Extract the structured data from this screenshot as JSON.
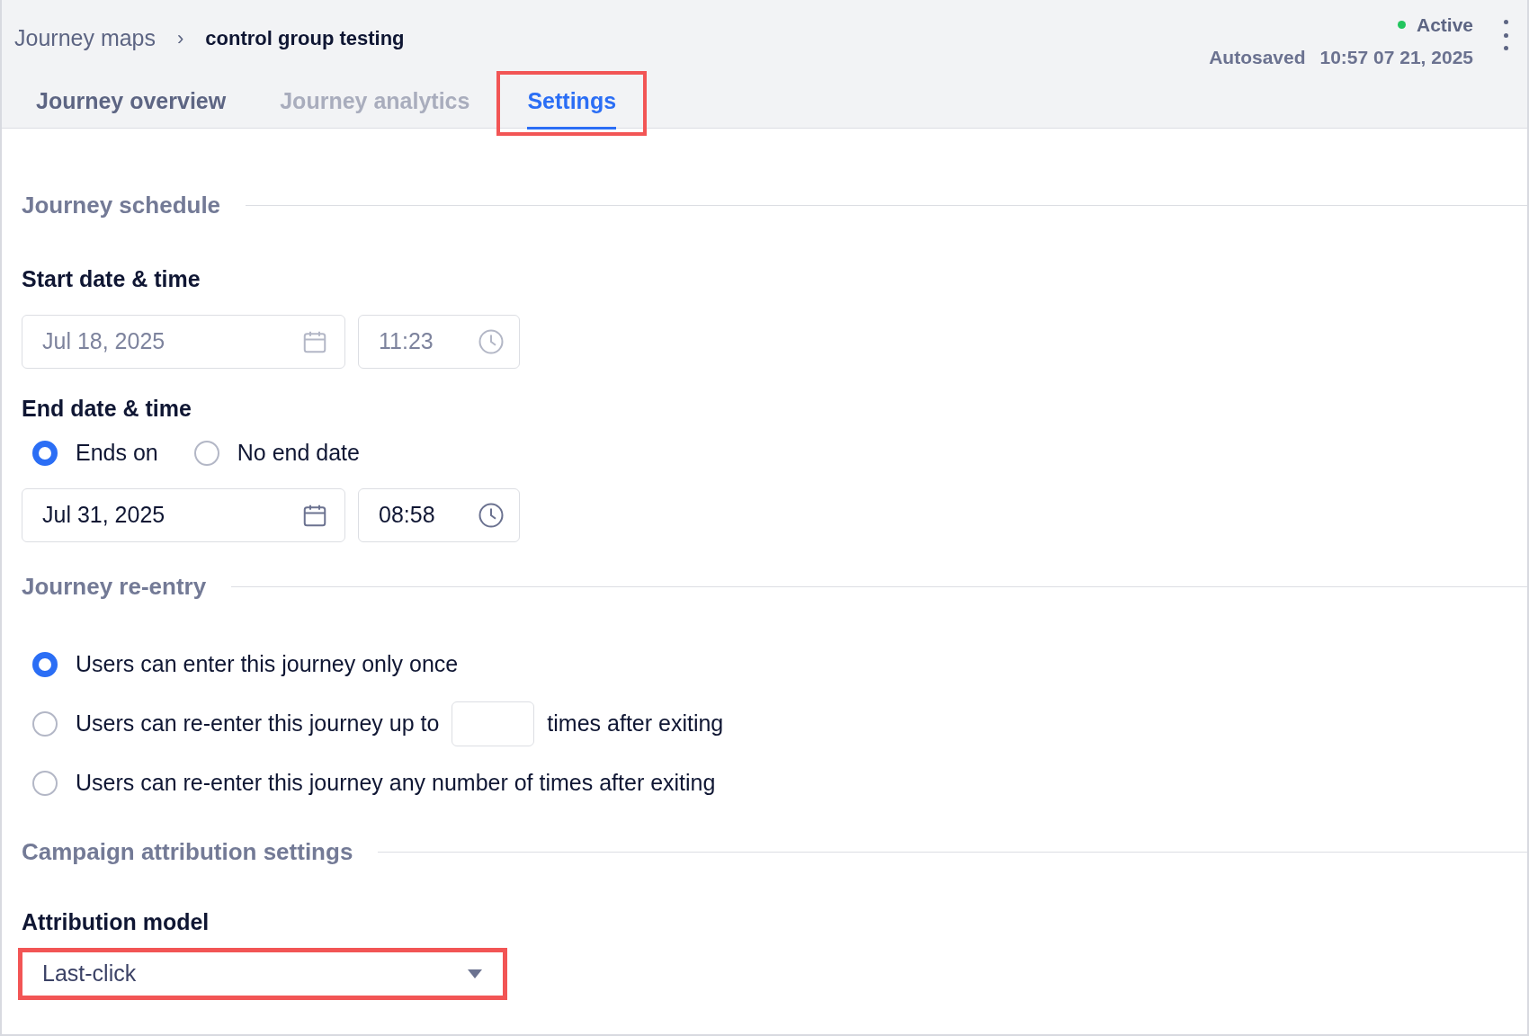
{
  "breadcrumb": {
    "parent": "Journey maps",
    "separator": "›",
    "current": "control group testing"
  },
  "status": {
    "label": "Active",
    "color": "#22c55e",
    "autosaved_label": "Autosaved",
    "autosaved_time": "10:57 07 21, 2025"
  },
  "tabs": [
    {
      "label": "Journey overview",
      "selected": false,
      "disabled": false,
      "highlighted": false
    },
    {
      "label": "Journey analytics",
      "selected": false,
      "disabled": true,
      "highlighted": false
    },
    {
      "label": "Settings",
      "selected": true,
      "disabled": false,
      "highlighted": true
    }
  ],
  "schedule": {
    "heading": "Journey schedule",
    "start": {
      "label": "Start date & time",
      "date": "Jul 18, 2025",
      "time": "11:23",
      "disabled": true
    },
    "end": {
      "label": "End date & time",
      "options": [
        {
          "label": "Ends on",
          "selected": true
        },
        {
          "label": "No end date",
          "selected": false
        }
      ],
      "date": "Jul 31, 2025",
      "time": "08:58",
      "disabled": false
    }
  },
  "reentry": {
    "heading": "Journey re-entry",
    "options": [
      {
        "kind": "plain",
        "label": "Users can enter this journey only once",
        "selected": true
      },
      {
        "kind": "count",
        "label": "Users can re-enter this journey up to",
        "suffix": "times after exiting",
        "selected": false
      },
      {
        "kind": "plain",
        "label": "Users can re-enter this journey any number of times after exiting",
        "selected": false
      }
    ]
  },
  "attribution": {
    "heading": "Campaign attribution settings",
    "label": "Attribution model",
    "value": "Last-click",
    "highlighted": true
  }
}
